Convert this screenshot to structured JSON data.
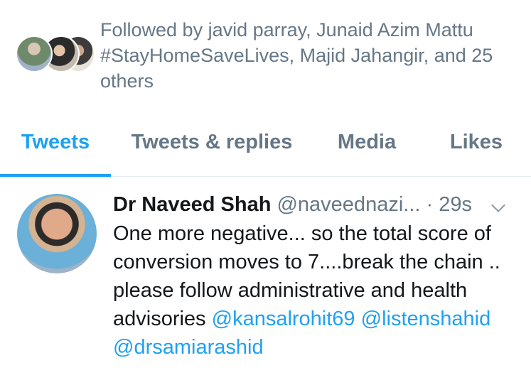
{
  "followed_by": {
    "text": "Followed by javid parray, Junaid Azim Mattu #StayHomeSaveLives, Majid Jahangir, and 25 others"
  },
  "tabs": [
    {
      "label": "Tweets",
      "active": true
    },
    {
      "label": "Tweets & replies",
      "active": false
    },
    {
      "label": "Media",
      "active": false
    },
    {
      "label": "Likes",
      "active": false
    }
  ],
  "tweet": {
    "name": "Dr Naveed Shah",
    "handle": "@naveednazi...",
    "time": "· 29s",
    "text": "One more negative... so the total score of conversion moves to 7....break the chain .. please follow administrative and health advisories",
    "mentions": [
      "@kansalrohit69",
      "@listenshahid",
      "@drsamiarashid"
    ]
  },
  "colors": {
    "accent": "#1da1f2",
    "secondary_text": "#657786"
  }
}
